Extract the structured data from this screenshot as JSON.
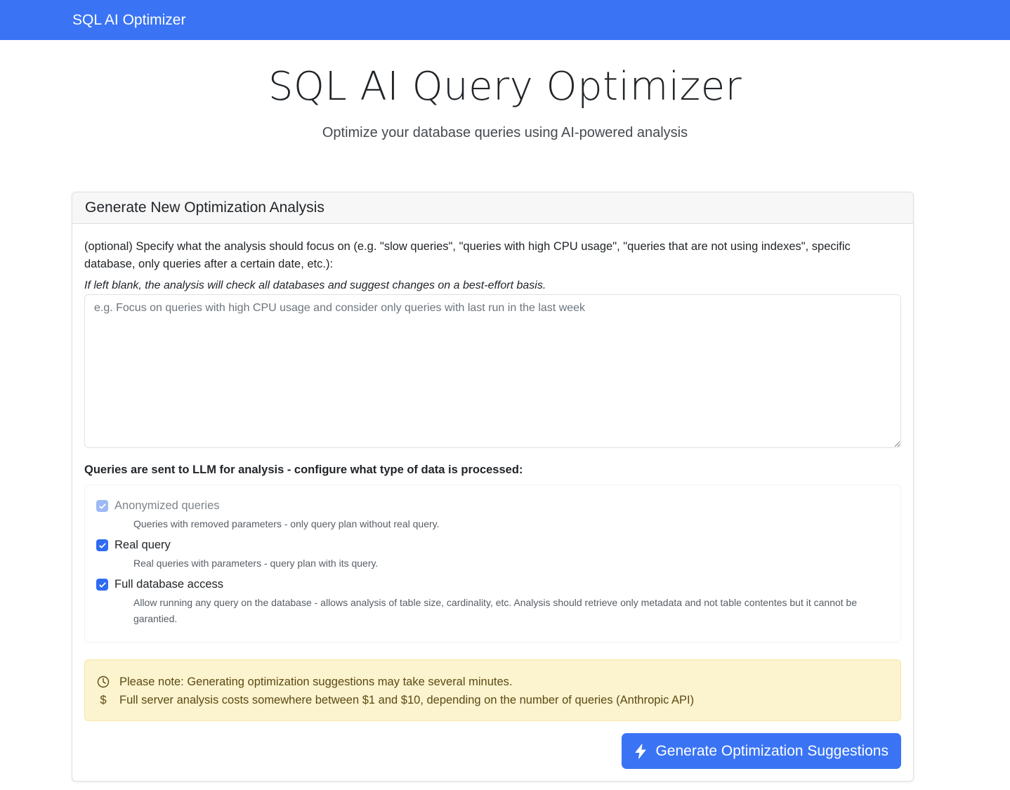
{
  "navbar": {
    "brand": "SQL AI Optimizer"
  },
  "hero": {
    "title": "SQL AI Query Optimizer",
    "subtitle": "Optimize your database queries using AI-powered analysis"
  },
  "card": {
    "header": "Generate New Optimization Analysis",
    "focus_label": "(optional) Specify what the analysis should focus on (e.g. \"slow queries\", \"queries with high CPU usage\", \"queries that are not using indexes\", specific database, only queries after a certain date, etc.):",
    "hint": "If left blank, the analysis will check all databases and suggest changes on a best-effort basis.",
    "textarea": {
      "value": "",
      "placeholder": "e.g. Focus on queries with high CPU usage and consider only queries with last run in the last week"
    },
    "options_title": "Queries are sent to LLM for analysis - configure what type of data is processed:",
    "options": [
      {
        "label": "Anonymized queries",
        "description": "Queries with removed parameters - only query plan without real query.",
        "checked": true,
        "disabled": true
      },
      {
        "label": "Real query",
        "description": "Real queries with parameters - query plan with its query.",
        "checked": true,
        "disabled": false
      },
      {
        "label": "Full database access",
        "description": "Allow running any query on the database - allows analysis of table size, cardinality, etc. Analysis should retrieve only metadata and not table contentes but it cannot be garantied.",
        "checked": true,
        "disabled": false
      }
    ],
    "alert": {
      "line1_icon": "clock-icon",
      "line1": "Please note: Generating optimization suggestions may take several minutes.",
      "line2_icon": "dollar-icon",
      "line2_symbol": "$",
      "line2": "Full server analysis costs somewhere between $1 and $10, depending on the number of queries (Anthropic API)"
    },
    "button": {
      "icon": "lightning-icon",
      "label": "Generate Optimization Suggestions"
    }
  },
  "colors": {
    "primary": "#3a74f5",
    "alert_bg": "#fcf3cf",
    "alert_text": "#5b4a12"
  }
}
